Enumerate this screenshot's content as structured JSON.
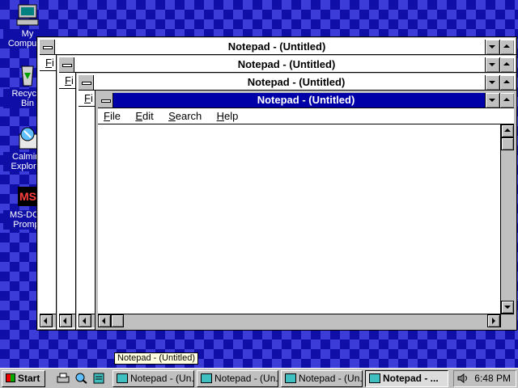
{
  "desktop": {
    "icons": [
      {
        "label": "My Computer",
        "icon": "my-computer-icon"
      },
      {
        "label": "Recycle Bin",
        "icon": "recycle-bin-icon"
      },
      {
        "label": "Calmira Explorer",
        "icon": "calmira-explorer-icon"
      },
      {
        "label": "MS-DOS Prompt",
        "icon": "ms-dos-prompt-icon"
      }
    ]
  },
  "windows": [
    {
      "title": "Notepad - (Untitled)",
      "menu": [
        "Fi"
      ]
    },
    {
      "title": "Notepad - (Untitled)",
      "menu": [
        "Fi"
      ]
    },
    {
      "title": "Notepad - (Untitled)",
      "menu": [
        "Fi"
      ]
    },
    {
      "title": "Notepad - (Untitled)",
      "menu": [
        "File",
        "Edit",
        "Search",
        "Help"
      ]
    }
  ],
  "tooltip": "Notepad - (Untitled)",
  "taskbar": {
    "start_label": "Start",
    "buttons": [
      "Notepad - (Un...",
      "Notepad - (Un...",
      "Notepad - (Un...",
      "Notepad - ..."
    ],
    "clock": "6:48 PM"
  },
  "colors": {
    "desktop": "#0f0fa8",
    "desktop_pattern": "#3c3cd8",
    "active_title": "#0000a8",
    "chrome": "#c0c0c0"
  }
}
